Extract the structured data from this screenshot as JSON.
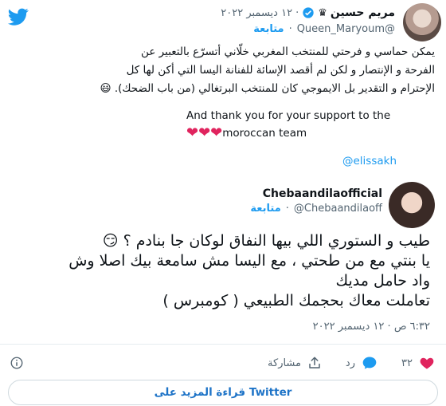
{
  "quoted_tweet": {
    "display_name": "مريم حسين",
    "crown": "♛",
    "handle": "@Queen_Maryoum",
    "date": "١٢ ديسمبر ٢٠٢٢",
    "follow_label": "متابعة",
    "text_lines": [
      "يمكن حماسي و فرحتي للمنتخب المغربي خلّاني أتسرّع بالتعبير عن",
      "الفرحة و الإنتصار و لكن لم أقصد الإسائة للفنانة اليسا التي أكن لها كل",
      "الإحترام و التقدير بل الايموجي كان للمنتخب البرتغالي (من باب الضحك). 😃"
    ],
    "english_line1": "And thank you for your support to the",
    "english_line2": "moroccan team",
    "hearts": "❤❤❤",
    "mention": "@elissakh"
  },
  "main_tweet": {
    "display_name": "Chebaandilaofficial",
    "handle": "@Chebaandilaoff",
    "follow_label": "متابعة",
    "text_lines": [
      "طيب و الستوري اللي بيها النفاق لوكان جا بنادم ؟ 😏",
      "يا بنتي مع من طحتي ، مع اليسا مش سامعة بيك اصلا وش",
      "واد حامل مديك",
      "تعاملت معاك بحجمك الطبيعي ( كومبرس )"
    ],
    "timestamp": "٦:٣٢ ص · ١٢ ديسمبر ٢٠٢٢"
  },
  "actions": {
    "likes_count": "٣٢",
    "reply_label": "رد",
    "share_label": "مشاركة"
  },
  "read_more_label": "قراءة المزيد على Twitter",
  "colors": {
    "accent": "#1d9bf0",
    "heart": "#e0245e",
    "verified": "#1d9bf0"
  }
}
